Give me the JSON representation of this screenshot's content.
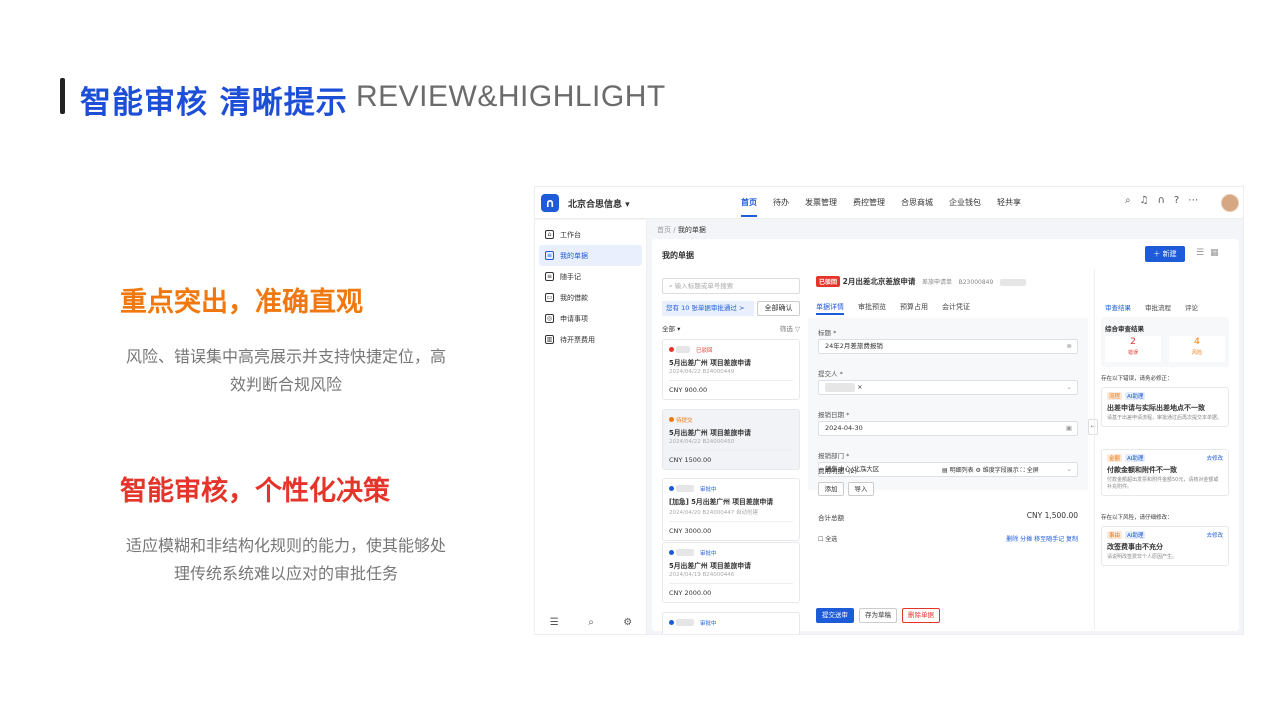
{
  "header": {
    "title_cn": "智能审核 清晰提示",
    "title_en": "REVIEW&HIGHLIGHT"
  },
  "left": {
    "section1_title": "重点突出，准确直观",
    "section1_desc_l1": "风险、错误集中高亮展示并支持快捷定位，高",
    "section1_desc_l2": "效判断合规风险",
    "section2_title": "智能审核，个性化决策",
    "section2_desc_l1": "适应模糊和非结构化规则的能力，使其能够处",
    "section2_desc_l2": "理传统系统难以应对的审批任务"
  },
  "app": {
    "company": "北京合思信息 ▾",
    "nav": [
      "首页",
      "待办",
      "发票管理",
      "费控管理",
      "合思商城",
      "企业钱包",
      "轻共享"
    ],
    "top_icons": [
      "search-icon",
      "bell-icon",
      "headset-icon",
      "help-icon",
      "more-icon"
    ],
    "sidebar": [
      {
        "label": "工作台",
        "icon": "home-icon"
      },
      {
        "label": "我的单据",
        "icon": "doc-icon"
      },
      {
        "label": "随手记",
        "icon": "note-icon"
      },
      {
        "label": "我的借款",
        "icon": "wallet-icon"
      },
      {
        "label": "申请事项",
        "icon": "apply-icon"
      },
      {
        "label": "待开票费用",
        "icon": "invoice-icon"
      }
    ],
    "breadcrumb_home": "首页",
    "breadcrumb_sep": "/",
    "breadcrumb_current": "我的单据",
    "panel_title": "我的单据",
    "new_button": "＋ 新建",
    "search_placeholder": "输入标题或单号搜索",
    "approve_bar": "您有 10 张单据审批通过 >",
    "confirm_all": "全部确认",
    "filter_all": "全部 ▾",
    "filter": "筛选 ▽",
    "cards": [
      {
        "status": "已驳回",
        "title": "5月出差广州    项目差旅申请",
        "meta": "2024/04/22  B24000449",
        "amount": "CNY 900.00",
        "dot": "#e5352b",
        "status_color": "#e5352b"
      },
      {
        "status": "待提交",
        "title": "5月出差广州    项目差旅申请",
        "meta": "2024/04/22  B24000450",
        "amount": "CNY 1500.00",
        "dot": "#f0780f",
        "status_color": "#f0780f"
      },
      {
        "status": "审批中",
        "title": "[加急] 5月出差广州    项目差旅申请",
        "meta": "2024/04/20  B24000447  自动创建",
        "amount": "CNY 3000.00",
        "dot": "#1e5bd8",
        "status_color": "#1e5bd8"
      },
      {
        "status": "审批中",
        "title": "5月出差广州    项目差旅申请",
        "meta": "2024/04/19  B24000446",
        "amount": "CNY 2000.00",
        "dot": "#1e5bd8",
        "status_color": "#1e5bd8"
      },
      {
        "status": "审批中",
        "title": "",
        "meta": "",
        "amount": "",
        "dot": "#1e5bd8",
        "status_color": "#1e5bd8"
      }
    ],
    "detail": {
      "tag": "已驳回",
      "title": "2月出差北京差旅申请",
      "type": "差旅申请单",
      "number": "B23000849",
      "tabs": [
        "单据详情",
        "审批预览",
        "预算占用",
        "会计凭证"
      ],
      "label_title": "标题 *",
      "value_title": "24年2月差旅费报销",
      "label_submitter": "提交人 *",
      "label_date": "报销日期 *",
      "value_date": "2024-04-30",
      "label_dept": "报销部门 *",
      "value_dept": "销售中心/北京大区",
      "fee_title": "费用明细（2） *",
      "fee_tools": "▤ 明细列表   ⚙ 维度字段展示   ⛶ 全屏",
      "add_btn": "添加",
      "import_btn": "导入",
      "total_label": "合计总额",
      "total_value": "CNY 1,500.00",
      "select_all": "全选",
      "row_actions": "删除   分摊   移至随手记   复制",
      "submit_btn": "提交送审",
      "draft_btn": "存为草稿",
      "delete_btn": "删除单据"
    },
    "review": {
      "tabs": [
        "审查结果",
        "审批流程",
        "评论"
      ],
      "summary_title": "综合审查结果",
      "errors_count": "2",
      "errors_label": "错误",
      "risks_count": "4",
      "risks_label": "风险",
      "note_errors": "存在以下错误，请务必修正：",
      "note_risks": "存在以下风险，请仔细修改：",
      "items": [
        {
          "tag1": "流程",
          "tag2": "AI助理",
          "edit": "",
          "title": "出差申请与实际出差地点不一致",
          "desc": "请基于出差申请流程，审批通过后再次提交本单据。"
        },
        {
          "tag1": "金额",
          "tag2": "AI助理",
          "edit": "去修改",
          "title": "付款金额和附件不一致",
          "desc": "付款金额超出发票和附件金额50元，请核对金额或补充附件。"
        },
        {
          "tag1": "事由",
          "tag2": "AI助理",
          "edit": "去修改",
          "title": "改签费事由不充分",
          "desc": "请说明改签费非个人原因产生。"
        }
      ]
    }
  }
}
